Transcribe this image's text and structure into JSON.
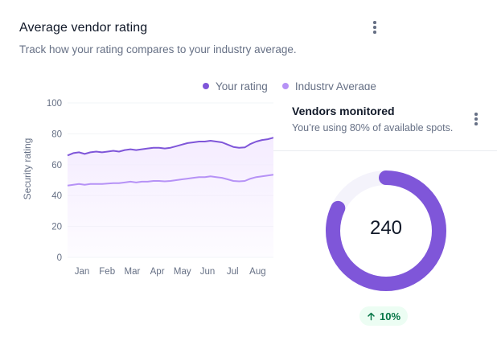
{
  "card": {
    "title": "Average vendor rating",
    "subtitle": "Track how your rating compares to your industry average."
  },
  "colors": {
    "your_rating": "#7f56d9",
    "industry": "#b692f6",
    "fill": "#f4ebff",
    "badge_bg": "#ecfdf3",
    "badge_text": "#067647",
    "track": "#f4f3fb"
  },
  "chart_data": {
    "type": "area",
    "ylabel": "Security rating",
    "ylim": [
      0,
      100
    ],
    "yticks": [
      0,
      20,
      40,
      60,
      80,
      100
    ],
    "months": [
      "Jan",
      "Feb",
      "Mar",
      "Apr",
      "May",
      "Jun",
      "Jul",
      "Aug"
    ],
    "grid": true,
    "legend": "top-right",
    "series": [
      {
        "name": "Your rating",
        "values": [
          66,
          67.5,
          68,
          67,
          68,
          68.5,
          68,
          68.5,
          69,
          68.5,
          69.5,
          70,
          69.5,
          70,
          70.5,
          71,
          71,
          70.5,
          71,
          72,
          73,
          74,
          74.5,
          75,
          75,
          75.5,
          75,
          74.5,
          73,
          71.5,
          71,
          71.2,
          73.5,
          75,
          76,
          76.5,
          77.5
        ]
      },
      {
        "name": "Industry Average",
        "values": [
          46.5,
          47,
          47.5,
          47,
          47.5,
          47.5,
          47.5,
          47.8,
          48,
          48,
          48.5,
          49,
          48.5,
          49,
          49,
          49.5,
          49.5,
          49.2,
          49.5,
          50,
          50.5,
          51,
          51.5,
          52,
          52,
          52.5,
          52,
          51.5,
          50.5,
          49.5,
          49.2,
          49.5,
          51,
          52,
          52.5,
          53,
          53.5
        ]
      }
    ]
  },
  "vendors": {
    "title": "Vendors monitored",
    "subtitle": "You’re using 80% of available spots.",
    "value": "240",
    "progress": 0.82,
    "badge": "10%"
  }
}
